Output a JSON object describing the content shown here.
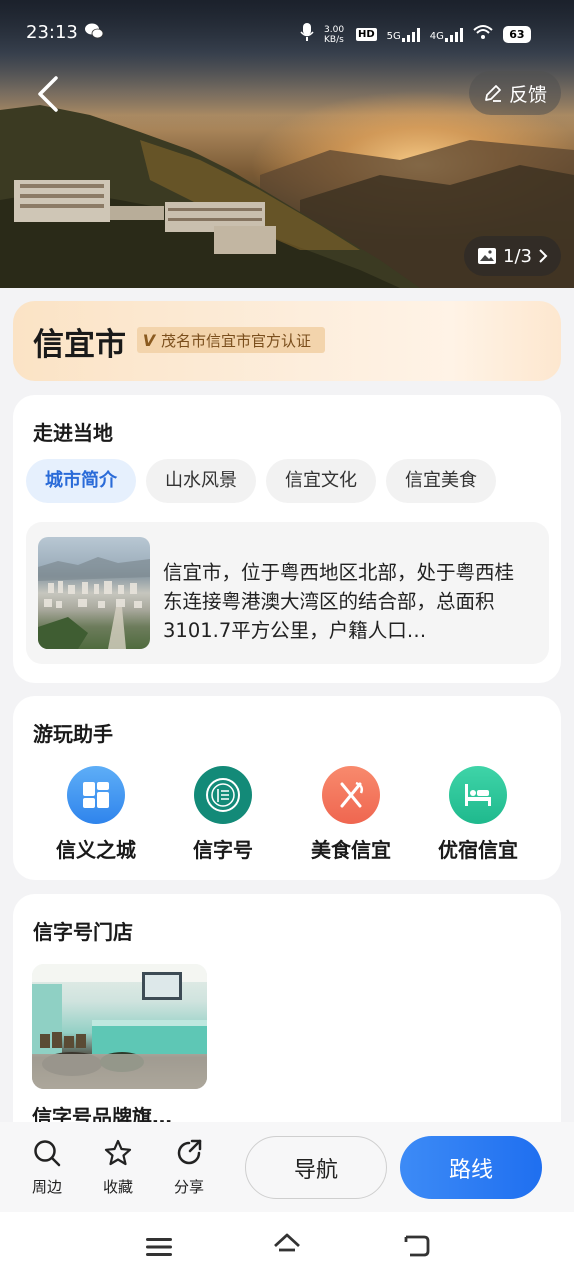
{
  "status_bar": {
    "time": "23:13",
    "net_speed": "3.00 KB/s",
    "hd": "HD",
    "sig1": "5G",
    "sig2": "4G",
    "battery": "63"
  },
  "header": {
    "feedback_label": "反馈",
    "photo_counter": "1/3"
  },
  "title_card": {
    "name": "信宜市",
    "cert_mark": "V",
    "cert_label": "茂名市信宜市官方认证"
  },
  "explore": {
    "title": "走进当地",
    "tabs": [
      "城市简介",
      "山水风景",
      "信宜文化",
      "信宜美食"
    ],
    "active_tab": 0,
    "intro_text": "信宜市，位于粤西地区北部，处于粤西桂东连接粤港澳大湾区的结合部，总面积3101.7平方公里，户籍人口…"
  },
  "assistant": {
    "title": "游玩助手",
    "tools": [
      {
        "label": "信义之城",
        "icon": "grid-icon",
        "color": "#3d93f0"
      },
      {
        "label": "信字号",
        "icon": "xin-seal-icon",
        "color": "#138a78"
      },
      {
        "label": "美食信宜",
        "icon": "fork-knife-icon",
        "color": "#f2735c"
      },
      {
        "label": "优宿信宜",
        "icon": "bed-icon",
        "color": "#2bc199"
      }
    ]
  },
  "stores": {
    "title": "信字号门店",
    "items": [
      {
        "name": "信字号品牌旗…"
      }
    ]
  },
  "action_bar": {
    "nearby": "周边",
    "favorite": "收藏",
    "share": "分享",
    "navigate": "导航",
    "route": "路线"
  }
}
